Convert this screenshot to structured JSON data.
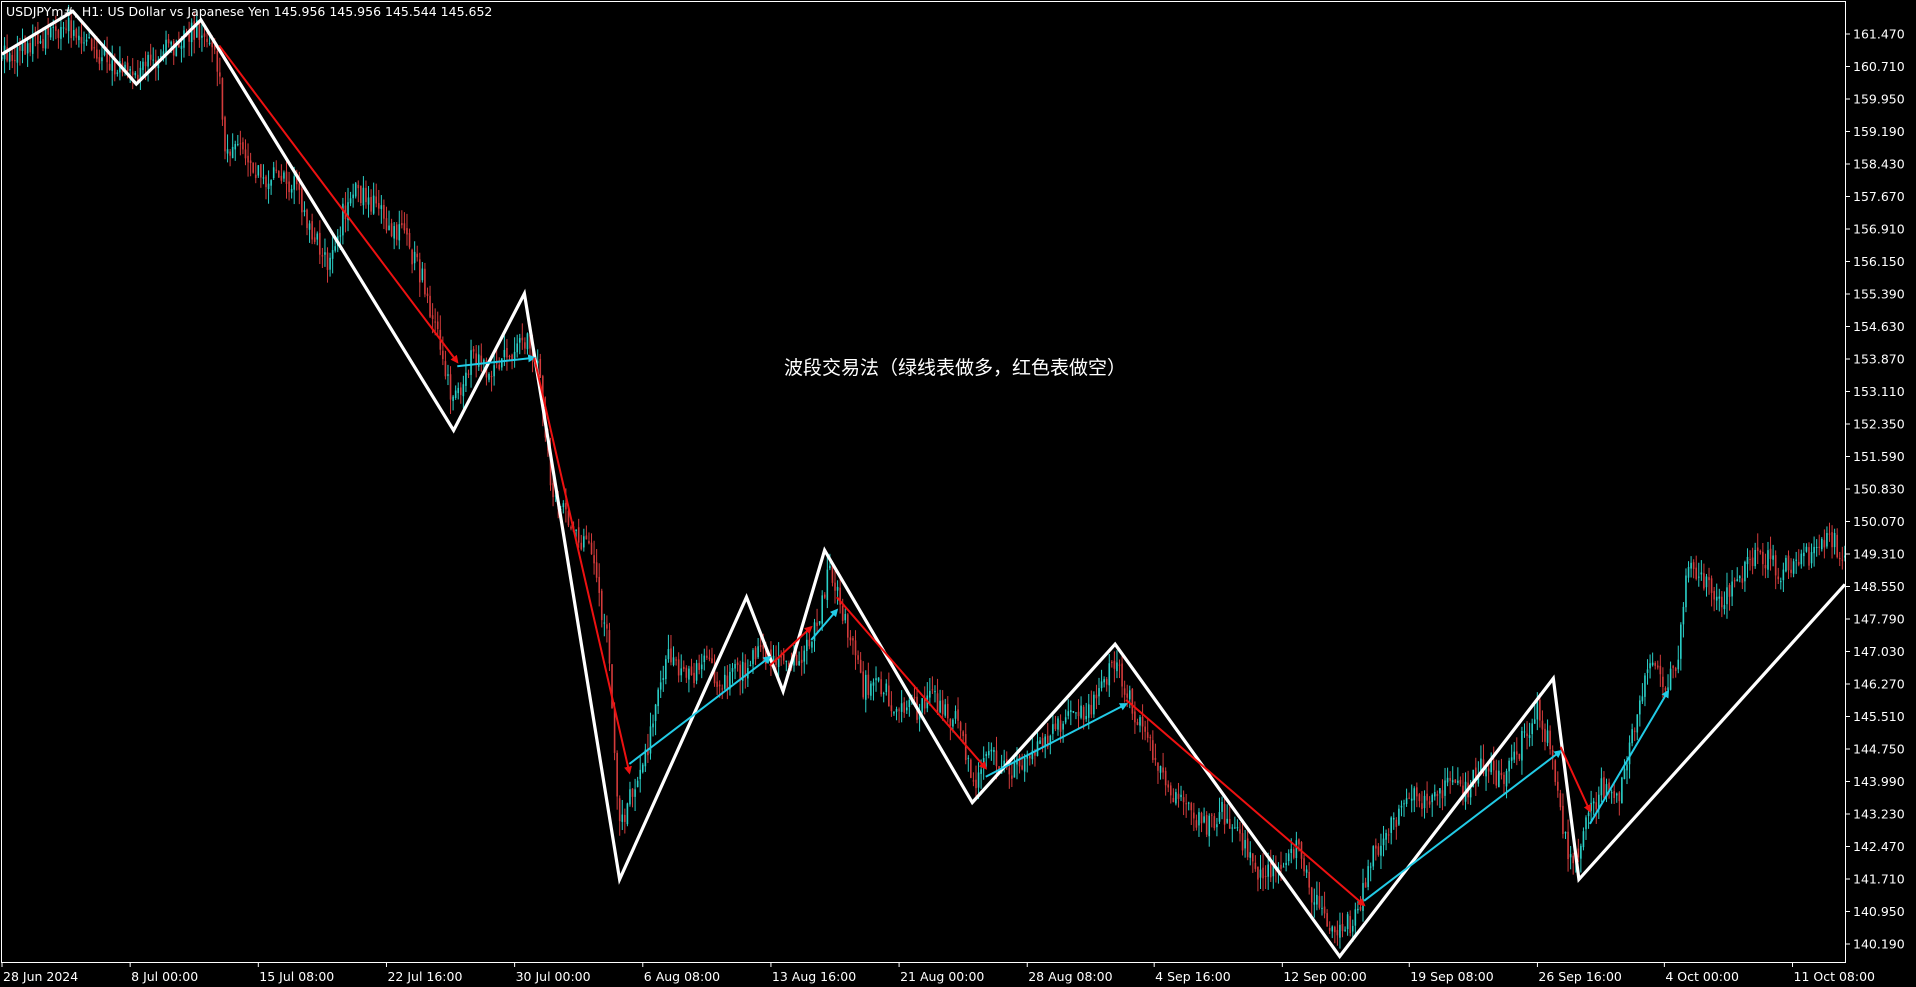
{
  "header": {
    "symbol": "USDJPYm#",
    "timeframe": "H1",
    "description": "US Dollar vs Japanese Yen",
    "ohlc": "145.956 145.956 145.544 145.652"
  },
  "colors": {
    "background": "#000000",
    "frame": "#ffffff",
    "zigzag": "#ffffff",
    "bull_candle": "#2ad0c8",
    "bear_candle": "#d33b3b",
    "long_arrow": "#22cbe6",
    "short_arrow": "#ee1111",
    "text": "#ffffff"
  },
  "chart_data": {
    "type": "line",
    "chart_kind": "candlestick price chart with zigzag swing lines and trade arrows",
    "annotation": "波段交易法（绿线表做多，红色表做空）",
    "y_axis": {
      "min": 139.7,
      "max": 162.3,
      "ticks": [
        161.47,
        160.71,
        159.95,
        159.19,
        158.43,
        157.67,
        156.91,
        156.15,
        155.39,
        154.63,
        153.87,
        153.11,
        152.35,
        151.59,
        150.83,
        150.07,
        149.31,
        148.55,
        147.79,
        147.03,
        146.27,
        145.51,
        144.75,
        143.99,
        143.23,
        142.47,
        141.71,
        140.95,
        140.19
      ],
      "tick_labels": [
        "161.470",
        "160.710",
        "159.950",
        "159.190",
        "158.430",
        "157.670",
        "156.910",
        "156.150",
        "155.390",
        "154.630",
        "153.870",
        "153.110",
        "152.350",
        "151.590",
        "150.830",
        "150.070",
        "149.310",
        "148.550",
        "147.790",
        "147.030",
        "146.270",
        "145.510",
        "144.750",
        "143.990",
        "143.230",
        "142.470",
        "141.710",
        "140.950",
        "140.190"
      ]
    },
    "x_axis": {
      "min": 0,
      "max": 1510,
      "ticks": [
        0,
        105,
        210,
        315,
        420,
        525,
        630,
        735,
        840,
        944,
        1049,
        1153,
        1258,
        1362,
        1467
      ],
      "tick_labels": [
        "28 Jun 2024",
        "8 Jul 00:00",
        "15 Jul 08:00",
        "22 Jul 16:00",
        "30 Jul 00:00",
        "6 Aug 08:00",
        "13 Aug 16:00",
        "21 Aug 00:00",
        "28 Aug 08:00",
        "4 Sep 16:00",
        "12 Sep 00:00",
        "19 Sep 08:00",
        "26 Sep 16:00",
        "4 Oct 00:00",
        "11 Oct 08:00"
      ]
    },
    "price_path": [
      [
        0,
        160.9
      ],
      [
        25,
        161.3
      ],
      [
        55,
        161.6
      ],
      [
        65,
        161.3
      ],
      [
        85,
        160.9
      ],
      [
        105,
        160.5
      ],
      [
        125,
        160.9
      ],
      [
        150,
        161.4
      ],
      [
        165,
        161.6
      ],
      [
        178,
        160.7
      ],
      [
        183,
        158.7
      ],
      [
        195,
        159.1
      ],
      [
        205,
        158.2
      ],
      [
        222,
        158.1
      ],
      [
        240,
        157.9
      ],
      [
        255,
        156.8
      ],
      [
        268,
        156.1
      ],
      [
        280,
        157.3
      ],
      [
        292,
        157.8
      ],
      [
        305,
        157.5
      ],
      [
        318,
        157.0
      ],
      [
        330,
        156.7
      ],
      [
        345,
        155.7
      ],
      [
        360,
        154.0
      ],
      [
        370,
        152.9
      ],
      [
        385,
        153.9
      ],
      [
        400,
        153.6
      ],
      [
        415,
        154.0
      ],
      [
        428,
        154.4
      ],
      [
        440,
        153.6
      ],
      [
        450,
        151.0
      ],
      [
        465,
        150.0
      ],
      [
        482,
        149.4
      ],
      [
        497,
        147.2
      ],
      [
        506,
        142.9
      ],
      [
        515,
        143.6
      ],
      [
        530,
        144.9
      ],
      [
        545,
        146.9
      ],
      [
        560,
        146.3
      ],
      [
        575,
        146.8
      ],
      [
        590,
        146.2
      ],
      [
        605,
        146.6
      ],
      [
        620,
        146.9
      ],
      [
        633,
        146.7
      ],
      [
        645,
        146.8
      ],
      [
        658,
        147.0
      ],
      [
        668,
        147.8
      ],
      [
        678,
        148.9
      ],
      [
        692,
        147.7
      ],
      [
        705,
        146.2
      ],
      [
        718,
        146.4
      ],
      [
        735,
        145.6
      ],
      [
        750,
        145.7
      ],
      [
        765,
        145.9
      ],
      [
        782,
        145.4
      ],
      [
        795,
        144.0
      ],
      [
        810,
        144.5
      ],
      [
        830,
        144.3
      ],
      [
        850,
        144.9
      ],
      [
        870,
        145.4
      ],
      [
        892,
        145.6
      ],
      [
        912,
        146.8
      ],
      [
        925,
        145.8
      ],
      [
        940,
        144.9
      ],
      [
        955,
        143.8
      ],
      [
        970,
        143.3
      ],
      [
        985,
        142.9
      ],
      [
        1000,
        143.3
      ],
      [
        1015,
        142.7
      ],
      [
        1030,
        141.7
      ],
      [
        1045,
        142.1
      ],
      [
        1060,
        142.5
      ],
      [
        1072,
        141.5
      ],
      [
        1085,
        140.7
      ],
      [
        1097,
        140.6
      ],
      [
        1110,
        140.8
      ],
      [
        1125,
        142.4
      ],
      [
        1140,
        143.1
      ],
      [
        1155,
        143.6
      ],
      [
        1170,
        143.4
      ],
      [
        1185,
        144.0
      ],
      [
        1200,
        143.8
      ],
      [
        1215,
        144.4
      ],
      [
        1230,
        144.0
      ],
      [
        1245,
        144.9
      ],
      [
        1258,
        145.7
      ],
      [
        1270,
        144.6
      ],
      [
        1278,
        142.9
      ],
      [
        1288,
        142.0
      ],
      [
        1295,
        142.9
      ],
      [
        1310,
        143.8
      ],
      [
        1325,
        143.5
      ],
      [
        1338,
        145.4
      ],
      [
        1350,
        146.8
      ],
      [
        1362,
        146.3
      ],
      [
        1372,
        146.6
      ],
      [
        1380,
        149.0
      ],
      [
        1395,
        148.6
      ],
      [
        1410,
        148.3
      ],
      [
        1425,
        148.8
      ],
      [
        1440,
        149.4
      ],
      [
        1455,
        148.9
      ],
      [
        1470,
        149.1
      ],
      [
        1485,
        149.3
      ],
      [
        1497,
        149.8
      ],
      [
        1510,
        149.2
      ]
    ],
    "series": [
      {
        "kind": "zigzag",
        "points": [
          [
            0,
            161.0
          ],
          [
            58,
            162.0
          ],
          [
            110,
            160.3
          ],
          [
            163,
            161.8
          ],
          [
            370,
            152.2
          ],
          [
            428,
            155.4
          ],
          [
            506,
            141.7
          ],
          [
            610,
            148.3
          ],
          [
            640,
            146.1
          ],
          [
            674,
            149.4
          ],
          [
            795,
            143.5
          ],
          [
            912,
            147.2
          ],
          [
            1096,
            139.9
          ],
          [
            1271,
            146.4
          ],
          [
            1292,
            141.7
          ],
          [
            1510,
            148.6
          ]
        ]
      }
    ],
    "arrows": [
      {
        "direction": "short",
        "from": [
          178,
          161.2
        ],
        "to": [
          373,
          153.8
        ]
      },
      {
        "direction": "long",
        "from": [
          373,
          153.7
        ],
        "to": [
          436,
          153.9
        ]
      },
      {
        "direction": "short",
        "from": [
          436,
          153.9
        ],
        "to": [
          514,
          144.2
        ]
      },
      {
        "direction": "long",
        "from": [
          514,
          144.4
        ],
        "to": [
          629,
          146.9
        ]
      },
      {
        "direction": "short",
        "from": [
          629,
          146.7
        ],
        "to": [
          663,
          147.6
        ]
      },
      {
        "direction": "long",
        "from": [
          663,
          147.3
        ],
        "to": [
          684,
          148.0
        ]
      },
      {
        "direction": "short",
        "from": [
          684,
          148.3
        ],
        "to": [
          806,
          144.3
        ]
      },
      {
        "direction": "long",
        "from": [
          806,
          144.1
        ],
        "to": [
          921,
          145.8
        ]
      },
      {
        "direction": "short",
        "from": [
          921,
          145.9
        ],
        "to": [
          1116,
          141.1
        ]
      },
      {
        "direction": "long",
        "from": [
          1116,
          141.2
        ],
        "to": [
          1277,
          144.7
        ]
      },
      {
        "direction": "short",
        "from": [
          1277,
          144.8
        ],
        "to": [
          1301,
          143.3
        ]
      },
      {
        "direction": "long",
        "from": [
          1301,
          143.0
        ],
        "to": [
          1365,
          146.1
        ]
      }
    ]
  }
}
